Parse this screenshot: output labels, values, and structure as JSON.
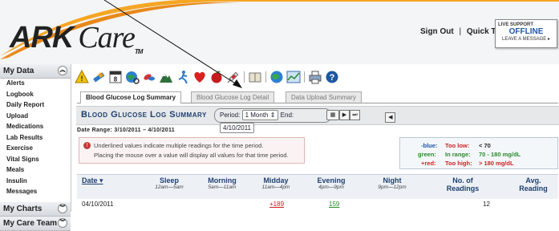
{
  "header": {
    "logo_ark": "ARK",
    "logo_care": "Care",
    "logo_tm": "TM",
    "sign_out": "Sign Out",
    "separator": "|",
    "quick_tour": "Quick Tour",
    "support": {
      "live": "LIVE SUPPORT",
      "status": "OFFLINE",
      "message": "LEAVE A MESSAGE ▸"
    }
  },
  "sidebar": {
    "section1": "My Data",
    "items": [
      "Alerts",
      "Logbook",
      "Daily Report",
      "Upload",
      "Medications",
      "Lab Results",
      "Exercise",
      "Vital Signs",
      "Meals",
      "Insulin",
      "Messages"
    ],
    "section2": "My Charts",
    "section3": "My Care Team"
  },
  "toolbar_icons": [
    "warning-icon",
    "syringe-pen-icon",
    "calendar-icon",
    "globe-search-icon",
    "pills-icon",
    "mountain-icon",
    "exercise-icon",
    "heart-icon",
    "apple-icon",
    "syringe-icon",
    "book-icon",
    "globe-icon",
    "chart-icon",
    "printer-icon",
    "help-icon"
  ],
  "tabs": [
    "Blood Glucose Log Summary",
    "Blood Glucose Log Detail",
    "Data Upload Summary"
  ],
  "summary": {
    "title": "Blood Glucose Log Summary",
    "period_label": "Period:",
    "period_value": "1 Month",
    "end_label": "End:",
    "end_value": "4/10/2011",
    "date_range": "Date Range: 3/10/2011 – 4/10/2011"
  },
  "note": {
    "line1": "Underlined values indicate multiple readings for the time period.",
    "line2": "Placing the mouse over a value will display all values for that time period."
  },
  "legend": {
    "blue_label": "-blue:",
    "blue_text": "Too low:",
    "blue_value": "< 70",
    "green_label": "green:",
    "green_text": "In range:",
    "green_value": "70 - 180 mg/dL",
    "red_label": "+red:",
    "red_text": "Too high:",
    "red_value": "> 180 mg/dL"
  },
  "colors": {
    "blue": "#1f56a6",
    "green": "#2b8a2b",
    "red": "#d02020",
    "header_text": "#1f3f70"
  },
  "table": {
    "columns": [
      {
        "label": "Date ▾",
        "sub": ""
      },
      {
        "label": "Sleep",
        "sub": "12am—5am"
      },
      {
        "label": "Morning",
        "sub": "5am—11am"
      },
      {
        "label": "Midday",
        "sub": "11am—4pm"
      },
      {
        "label": "Evening",
        "sub": "4pm—9pm"
      },
      {
        "label": "Night",
        "sub": "9pm—12pm"
      },
      {
        "label": "No. of",
        "sub": "Readings"
      },
      {
        "label": "Avg.",
        "sub": "Reading"
      }
    ],
    "rows": [
      {
        "date": "04/10/2011",
        "sleep": "",
        "morning": "",
        "midday": "+189",
        "evening": "159",
        "night": "",
        "count": "12",
        "avg": ""
      }
    ]
  }
}
